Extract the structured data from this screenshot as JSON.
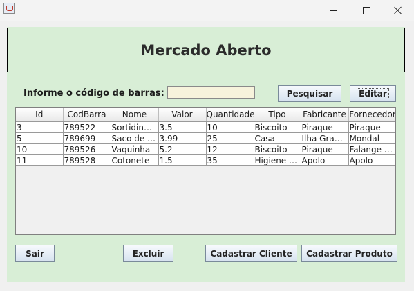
{
  "window": {
    "minimize": "—",
    "maximize": "☐",
    "close": "✕"
  },
  "header": {
    "title": "Mercado Aberto"
  },
  "search": {
    "label": "Informe o código de barras:",
    "value": "",
    "placeholder": ""
  },
  "buttons": {
    "pesquisar": "Pesquisar",
    "editar": "Editar",
    "sair": "Sair",
    "excluir": "Excluir",
    "cadastrar_cliente": "Cadastrar Cliente",
    "cadastrar_produto": "Cadastrar Produto"
  },
  "table": {
    "columns": [
      "Id",
      "CodBarra",
      "Nome",
      "Valor",
      "Quantidade",
      "Tipo",
      "Fabricante",
      "Fornecedor"
    ],
    "rows": [
      [
        "3",
        "789522",
        "Sortidinhos",
        "3.5",
        "10",
        "Biscoito",
        "Piraque",
        "Piraque"
      ],
      [
        "5",
        "789699",
        "Saco de li...",
        "3.99",
        "25",
        "Casa",
        "Ilha Grande",
        "Mondal"
      ],
      [
        "10",
        "789526",
        "Vaquinha",
        "5.2",
        "12",
        "Biscoito",
        "Piraque",
        "Falange L..."
      ],
      [
        "11",
        "789528",
        "Cotonete",
        "1.5",
        "35",
        "Higiene P...",
        "Apolo",
        "Apolo"
      ]
    ]
  },
  "colors": {
    "panel": "#d8eed6",
    "input_bg": "#f7f3dc"
  }
}
